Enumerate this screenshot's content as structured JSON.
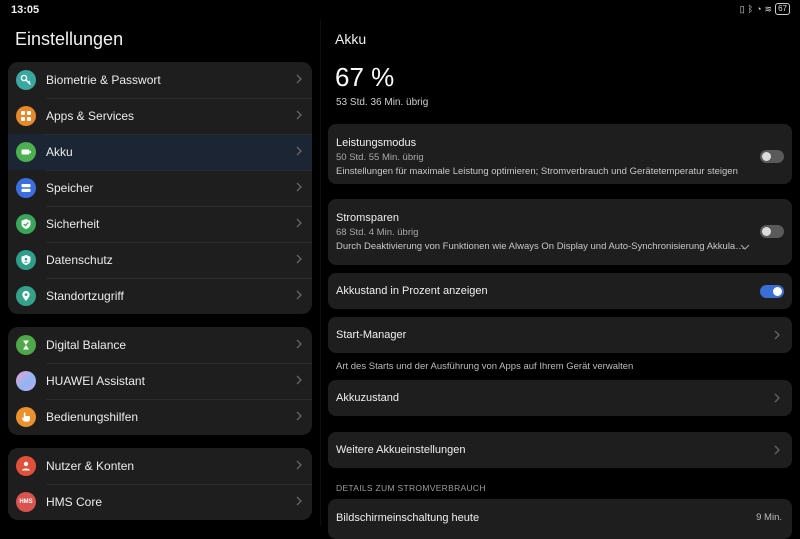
{
  "status": {
    "time": "13:05",
    "battery": "67"
  },
  "left": {
    "title": "Einstellungen",
    "group1": [
      {
        "label": "Biometrie & Passwort",
        "icon": "key-icon",
        "color": "#3aa7a0"
      },
      {
        "label": "Apps & Services",
        "icon": "apps-icon",
        "color": "#e48a2b"
      },
      {
        "label": "Akku",
        "icon": "battery-icon",
        "color": "#4caf50"
      },
      {
        "label": "Speicher",
        "icon": "storage-icon",
        "color": "#3b6fe0"
      },
      {
        "label": "Sicherheit",
        "icon": "shield-check-icon",
        "color": "#3aa65a"
      },
      {
        "label": "Datenschutz",
        "icon": "privacy-shield-icon",
        "color": "#2e9e8a"
      },
      {
        "label": "Standortzugriff",
        "icon": "location-pin-icon",
        "color": "#35a18b"
      }
    ],
    "group2": [
      {
        "label": "Digital Balance",
        "icon": "hourglass-icon",
        "color": "#4fa84a"
      },
      {
        "label": "HUAWEI Assistant",
        "icon": "assistant-icon",
        "color": "#b38ce8"
      },
      {
        "label": "Bedienungshilfen",
        "icon": "hand-icon",
        "color": "#e9912e"
      }
    ],
    "group3": [
      {
        "label": "Nutzer & Konten",
        "icon": "user-icon",
        "color": "#e0503a"
      },
      {
        "label": "HMS Core",
        "icon": "hms-icon",
        "text": "HMS",
        "color": "#d9534f"
      }
    ]
  },
  "right": {
    "title": "Akku",
    "percent": "67 %",
    "remaining": "53 Std. 36 Min. übrig",
    "performance": {
      "title": "Leistungsmodus",
      "sub": "50 Std. 55 Min. übrig",
      "desc": "Einstellungen für maximale Leistung optimieren; Stromverbrauch und Gerätetemperatur steigen",
      "on": false
    },
    "powersave": {
      "title": "Stromsparen",
      "sub": "68 Std. 4 Min. übrig",
      "desc": "Durch Deaktivierung von Funktionen wie Always On Display und Auto-Synchronisierung Akkula…",
      "on": false
    },
    "show_percent": {
      "label": "Akkustand in Prozent anzeigen",
      "on": true
    },
    "start_manager": {
      "label": "Start-Manager",
      "hint": "Art des Starts und der Ausführung von Apps auf Ihrem Gerät verwalten"
    },
    "battery_health": {
      "label": "Akkuzustand"
    },
    "more_settings": {
      "label": "Weitere Akkueinstellungen"
    },
    "section_header": "DETAILS ZUM STROMVERBRAUCH",
    "screen_on": {
      "label": "Bildschirmeinschaltung heute",
      "value": "9 Min."
    }
  }
}
